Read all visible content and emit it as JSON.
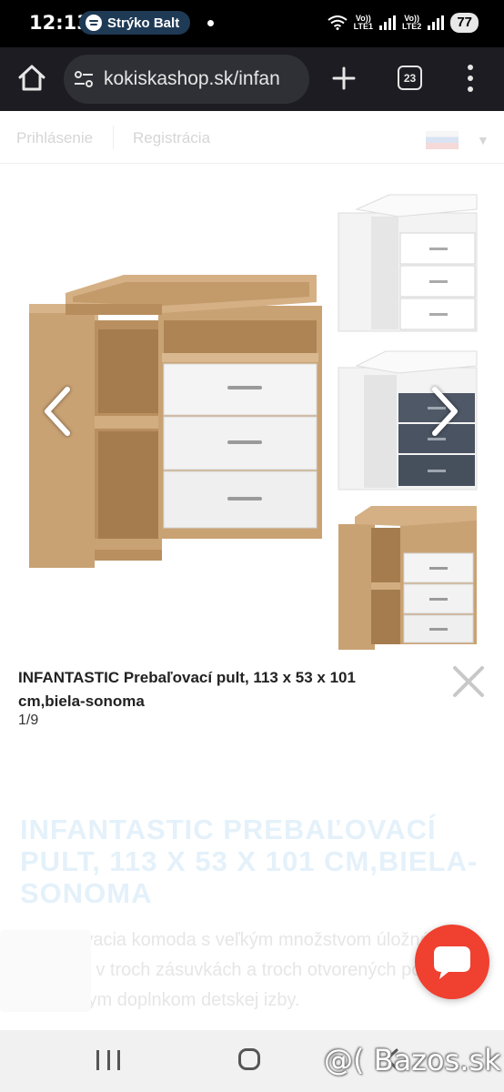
{
  "status_bar": {
    "time": "12:13",
    "media_label": "Strýko Balt",
    "network1_label_top": "Vo))",
    "network1_label_bottom": "LTE1",
    "network2_label_top": "Vo))",
    "network2_label_bottom": "LTE2",
    "battery": "77"
  },
  "browser": {
    "url": "kokiskashop.sk/infan",
    "tab_count": "23"
  },
  "background_page": {
    "login": "Prihlásenie",
    "register": "Registrácia",
    "product_title": "INFANTASTIC PREBAĽOVACÍ PULT, 113 X 53 X 101 CM,BIELA-SONOMA",
    "description": "Prebaľovacia komoda s veľkým množstvom úložného priestoru v troch zásuvkách a troch otvorených policiach je ideálnym doplnkom detskej izby."
  },
  "lightbox": {
    "caption": "INFANTASTIC Prebaľovací pult, 113 x 53 x 101 cm,biela-sonoma",
    "counter": "1/9"
  },
  "watermark": "@( Bazos.sk",
  "colors": {
    "chat_button": "#ef4030",
    "oak": "#c9a274",
    "drawer_white": "#f4f4f4",
    "drawer_grey": "#4f5866"
  }
}
